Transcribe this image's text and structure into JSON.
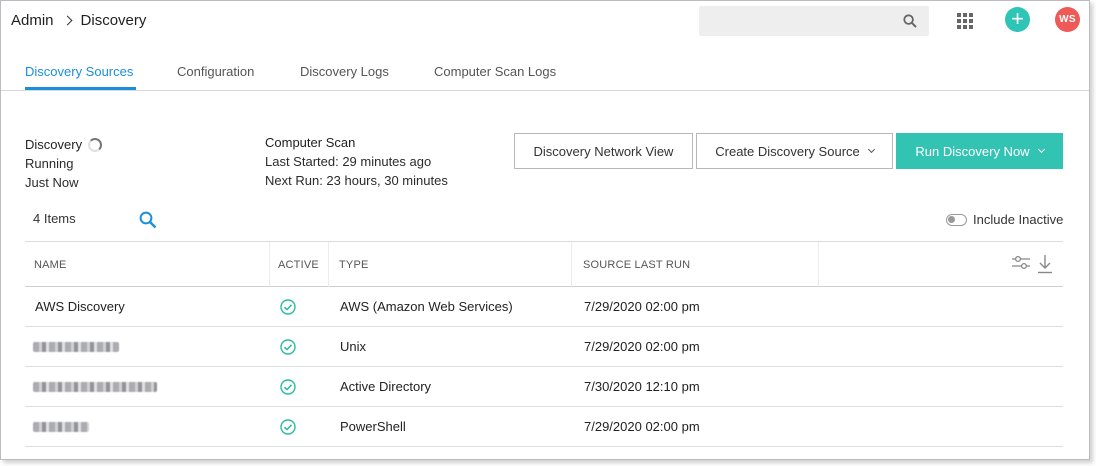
{
  "breadcrumb": {
    "root": "Admin",
    "current": "Discovery"
  },
  "header": {
    "search_placeholder": "",
    "avatar_initials": "WS",
    "add_symbol": "+"
  },
  "tabs": [
    {
      "label": "Discovery Sources",
      "active": true
    },
    {
      "label": "Configuration",
      "active": false
    },
    {
      "label": "Discovery Logs",
      "active": false
    },
    {
      "label": "Computer Scan Logs",
      "active": false
    }
  ],
  "discovery_status": {
    "title": "Discovery",
    "state": "Running",
    "when": "Just Now"
  },
  "computer_scan": {
    "title": "Computer Scan",
    "last_started": "Last Started: 29 minutes ago",
    "next_run": "Next Run: 23 hours, 30 minutes"
  },
  "actions": {
    "network_view": "Discovery Network View",
    "create_source": "Create Discovery Source",
    "run_now": "Run Discovery Now"
  },
  "list": {
    "count_label": "4 Items",
    "include_inactive_label": "Include Inactive",
    "include_inactive": false
  },
  "table": {
    "columns": [
      "NAME",
      "ACTIVE",
      "TYPE",
      "SOURCE LAST RUN"
    ],
    "rows": [
      {
        "name": "AWS Discovery",
        "name_redacted": false,
        "active": true,
        "type": "AWS (Amazon Web Services)",
        "last_run": "7/29/2020 02:00 pm"
      },
      {
        "name": "",
        "name_redacted": true,
        "active": true,
        "type": "Unix",
        "last_run": "7/29/2020 02:00 pm"
      },
      {
        "name": "",
        "name_redacted": true,
        "active": true,
        "type": "Active Directory",
        "last_run": "7/30/2020 12:10 pm"
      },
      {
        "name": "",
        "name_redacted": true,
        "active": true,
        "type": "PowerShell",
        "last_run": "7/29/2020 02:00 pm"
      }
    ]
  },
  "colors": {
    "accent": "#1a90d8",
    "primary_button": "#32c3b3",
    "add_button": "#2ec4b6",
    "avatar": "#ee5a57",
    "active_check": "#2eb8a0"
  }
}
